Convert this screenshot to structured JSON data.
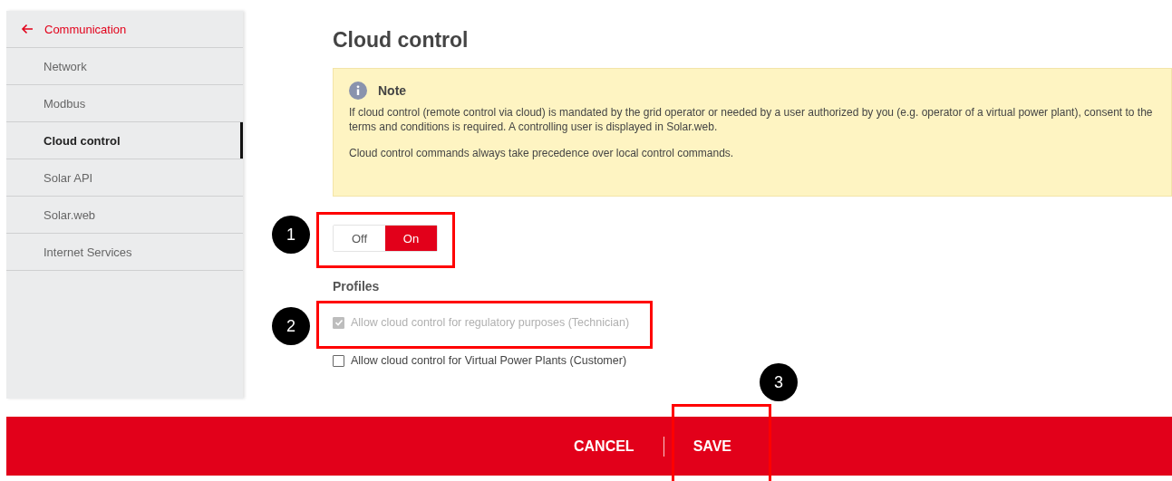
{
  "sidebar": {
    "back": {
      "label": "Communication"
    },
    "items": [
      {
        "label": "Network",
        "selected": false
      },
      {
        "label": "Modbus",
        "selected": false
      },
      {
        "label": "Cloud control",
        "selected": true
      },
      {
        "label": "Solar API",
        "selected": false
      },
      {
        "label": "Solar.web",
        "selected": false
      },
      {
        "label": "Internet Services",
        "selected": false
      }
    ]
  },
  "page": {
    "title": "Cloud control",
    "note": {
      "title": "Note",
      "paragraphs": [
        "If cloud control (remote control via cloud) is mandated by the grid operator or needed by a user authorized by you (e.g. operator of a virtual power plant), consent to the terms and conditions is required. A controlling user is displayed in Solar.web.",
        "Cloud control commands always take precedence over local control commands."
      ]
    },
    "toggle": [
      {
        "label": "Off",
        "selected": false
      },
      {
        "label": "On",
        "selected": true
      }
    ],
    "profiles": {
      "title": "Profiles",
      "options": [
        {
          "label": "Allow cloud control for regulatory purposes (Technician)",
          "checked": true,
          "disabled": true
        },
        {
          "label": "Allow cloud control for Virtual Power Plants (Customer)",
          "checked": false,
          "disabled": false
        }
      ]
    }
  },
  "footer": {
    "buttons": [
      "CANCEL",
      "SAVE"
    ]
  },
  "annotations": [
    {
      "label": "1"
    },
    {
      "label": "2"
    },
    {
      "label": "3"
    }
  ]
}
